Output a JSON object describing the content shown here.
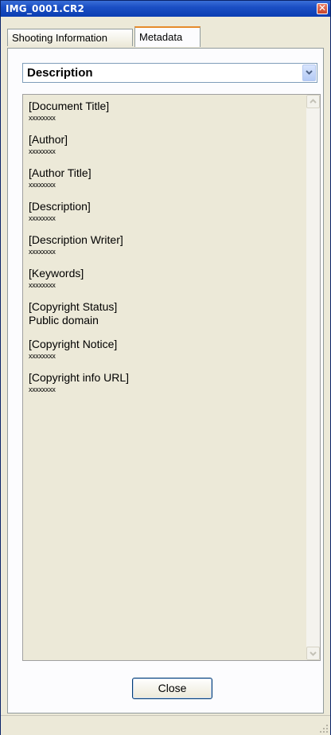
{
  "window": {
    "title": "IMG_0001.CR2",
    "close_glyph": "✕"
  },
  "tabs": [
    {
      "label": "Shooting Information",
      "selected": false
    },
    {
      "label": "Metadata",
      "selected": true
    }
  ],
  "dropdown": {
    "selected": "Description"
  },
  "fields": [
    {
      "label": "[Document Title]",
      "value": "xxxxxxxx"
    },
    {
      "label": "[Author]",
      "value": "xxxxxxxx"
    },
    {
      "label": "[Author Title]",
      "value": "xxxxxxxx"
    },
    {
      "label": "[Description]",
      "value": "xxxxxxxx"
    },
    {
      "label": "[Description Writer]",
      "value": "xxxxxxxx"
    },
    {
      "label": "[Keywords]",
      "value": "xxxxxxxx"
    },
    {
      "label": "[Copyright Status]",
      "value": "Public domain"
    },
    {
      "label": "[Copyright Notice]",
      "value": "xxxxxxxx"
    },
    {
      "label": "[Copyright info URL]",
      "value": "xxxxxxxx"
    }
  ],
  "buttons": {
    "close_label": "Close"
  },
  "colors": {
    "titlebar": "#0a3db2",
    "tab_accent": "#e68b2c",
    "window_bg": "#ece9d8"
  }
}
